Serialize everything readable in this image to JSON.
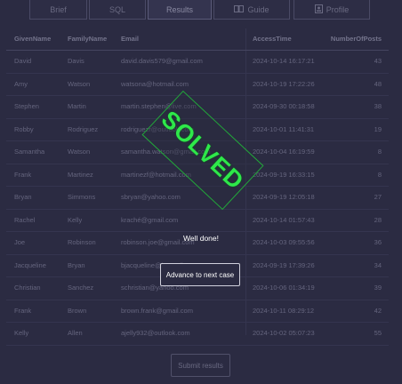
{
  "tabs": [
    {
      "label": "Brief",
      "icon": ""
    },
    {
      "label": "SQL",
      "icon": ""
    },
    {
      "label": "Results",
      "icon": ""
    },
    {
      "label": "Guide",
      "icon": "book-icon"
    },
    {
      "label": "Profile",
      "icon": "id-card-icon"
    }
  ],
  "table": {
    "headers": [
      "GivenName",
      "FamilyName",
      "Email",
      "AccessTime",
      "NumberOfPosts"
    ],
    "rows": [
      [
        "David",
        "Davis",
        "david.davis579@gmail.com",
        "2024-10-14 16:17:21",
        "43"
      ],
      [
        "Amy",
        "Watson",
        "watsona@hotmail.com",
        "2024-10-19 17:22:26",
        "48"
      ],
      [
        "Stephen",
        "Martin",
        "martin.stephen@live.com",
        "2024-09-30 00:18:58",
        "38"
      ],
      [
        "Robby",
        "Rodriguez",
        "rodriguezr@outlook.com",
        "2024-10-01 11:41:31",
        "19"
      ],
      [
        "Samantha",
        "Watson",
        "samantha.watson@gmail.com",
        "2024-10-04 16:19:59",
        "8"
      ],
      [
        "Frank",
        "Martinez",
        "martinezf@hotmail.com",
        "2024-09-19 16:33:15",
        "8"
      ],
      [
        "Bryan",
        "Simmons",
        "sbryan@yahoo.com",
        "2024-09-19 12:05:18",
        "27"
      ],
      [
        "Rachel",
        "Kelly",
        "kraché@gmail.com",
        "2024-10-14 01:57:43",
        "28"
      ],
      [
        "Joe",
        "Robinson",
        "robinson.joe@gmail.com",
        "2024-10-03 09:55:56",
        "36"
      ],
      [
        "Jacqueline",
        "Bryan",
        "bjacqueline@hotmail.com",
        "2024-09-19 17:39:26",
        "34"
      ],
      [
        "Christian",
        "Sanchez",
        "schristian@yahoo.com",
        "2024-10-06 01:34:19",
        "39"
      ],
      [
        "Frank",
        "Brown",
        "brown.frank@gmail.com",
        "2024-10-11 08:29:12",
        "42"
      ],
      [
        "Kelly",
        "Allen",
        "ajelly932@outlook.com",
        "2024-10-02 05:07:23",
        "55"
      ]
    ]
  },
  "stamp": {
    "text": "SOLVED",
    "color": "#2ee84a"
  },
  "message": "Well done!",
  "advance_label": "Advance to next case",
  "submit_label": "Submit results"
}
